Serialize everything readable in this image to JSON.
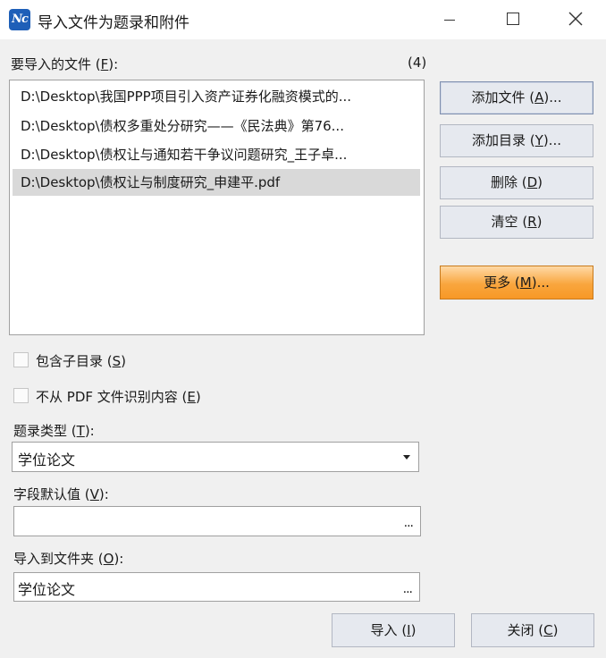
{
  "window": {
    "title": "导入文件为题录和附件",
    "app_icon_text": "Nc",
    "accent_color": "#1e5fb8"
  },
  "files": {
    "label": "要导入的文件",
    "accelerator": "F",
    "count": "(4)",
    "items": [
      {
        "path": "D:\\Desktop\\我国PPP项目引入资产证券化融资模式的...",
        "selected": false
      },
      {
        "path": "D:\\Desktop\\债权多重处分研究——《民法典》第76...",
        "selected": false
      },
      {
        "path": "D:\\Desktop\\债权让与通知若干争议问题研究_王子卓...",
        "selected": false
      },
      {
        "path": "D:\\Desktop\\债权让与制度研究_申建平.pdf",
        "selected": true
      }
    ]
  },
  "buttons": {
    "add_file": {
      "label": "添加文件",
      "accel": "A",
      "suffix": "..."
    },
    "add_dir": {
      "label": "添加目录",
      "accel": "Y",
      "suffix": "..."
    },
    "delete": {
      "label": "删除",
      "accel": "D",
      "suffix": ""
    },
    "clear": {
      "label": "清空",
      "accel": "R",
      "suffix": ""
    },
    "more": {
      "label": "更多",
      "accel": "M",
      "suffix": "...",
      "color": "#f9a63e"
    },
    "import": {
      "label": "导入",
      "accel": "I",
      "suffix": ""
    },
    "close": {
      "label": "关闭",
      "accel": "C",
      "suffix": ""
    }
  },
  "options": {
    "include_subdirs": {
      "label": "包含子目录",
      "accel": "S",
      "checked": false
    },
    "no_pdf_recognition": {
      "label": "不从 PDF 文件识别内容",
      "accel": "E",
      "checked": false
    }
  },
  "record_type": {
    "label": "题录类型",
    "accel": "T",
    "value": "学位论文"
  },
  "field_defaults": {
    "label": "字段默认值",
    "accel": "V",
    "value": "",
    "browse": "..."
  },
  "import_folder": {
    "label": "导入到文件夹",
    "accel": "O",
    "value": "学位论文",
    "browse": "..."
  }
}
